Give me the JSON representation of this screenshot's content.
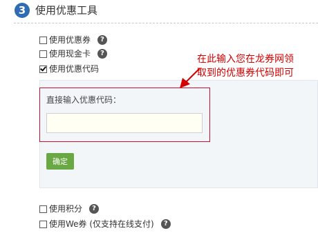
{
  "header": {
    "step_number": "3",
    "title": "使用优惠工具"
  },
  "options_top": [
    {
      "label": "使用优惠券",
      "checked": false,
      "help": true
    },
    {
      "label": "使用现金卡",
      "checked": false,
      "help": true
    },
    {
      "label": "使用优惠代码",
      "checked": true,
      "help": false
    }
  ],
  "coupon_panel": {
    "label": "直接输入优惠代码：",
    "input_value": "",
    "input_placeholder": "",
    "confirm_label": "确定"
  },
  "annotation": {
    "line1": "在此输入您在龙券网领",
    "line2": "取到的优惠券代码即可",
    "color": "#d40000"
  },
  "options_bottom": [
    {
      "label": "使用积分",
      "checked": false,
      "help": true
    },
    {
      "label": "使用We券 (仅支持在线支付)",
      "checked": false,
      "help": true
    }
  ],
  "help_glyph": "?",
  "colors": {
    "step_circle": "#2f6cb3",
    "confirm_button": "#6aa844",
    "highlight_border": "#c8102e"
  }
}
